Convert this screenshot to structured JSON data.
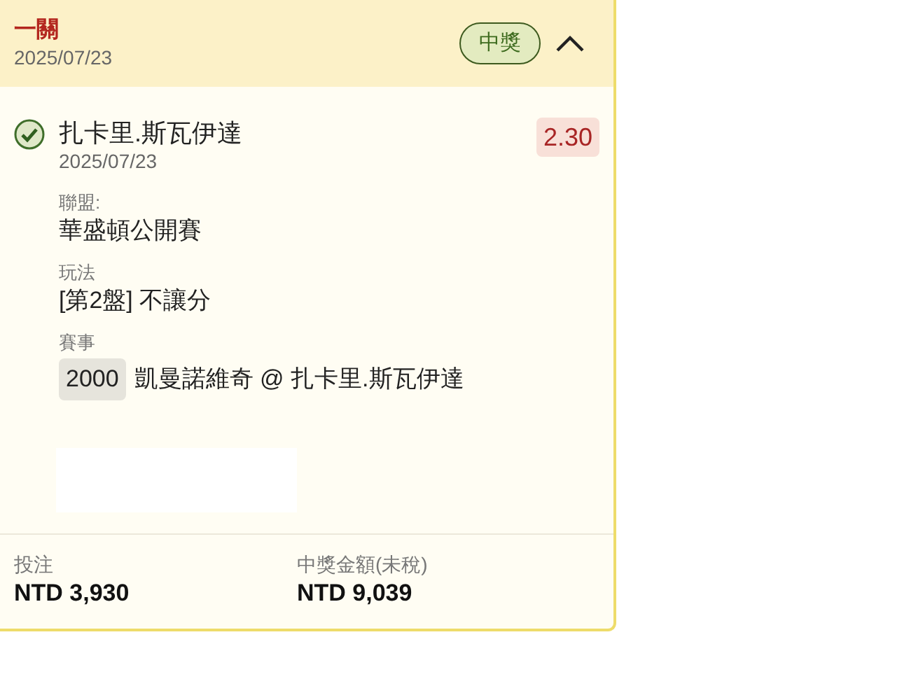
{
  "header": {
    "title": "一關",
    "date": "2025/07/23",
    "status_badge": "中獎",
    "expanded": true
  },
  "selection": {
    "won": true,
    "name": "扎卡里.斯瓦伊達",
    "date": "2025/07/23",
    "odds": "2.30",
    "fields": [
      {
        "kind": "text",
        "label": "聯盟:",
        "value": "華盛頓公開賽"
      },
      {
        "kind": "text",
        "label": "玩法",
        "value": "[第2盤] 不讓分"
      },
      {
        "kind": "event",
        "label": "賽事",
        "code": "2000",
        "value": "凱曼諾維奇 @ 扎卡里.斯瓦伊達"
      }
    ]
  },
  "footer": [
    {
      "label": "投注",
      "value": "NTD 3,930"
    },
    {
      "label": "中獎金額(未稅)",
      "value": "NTD 9,039"
    }
  ]
}
